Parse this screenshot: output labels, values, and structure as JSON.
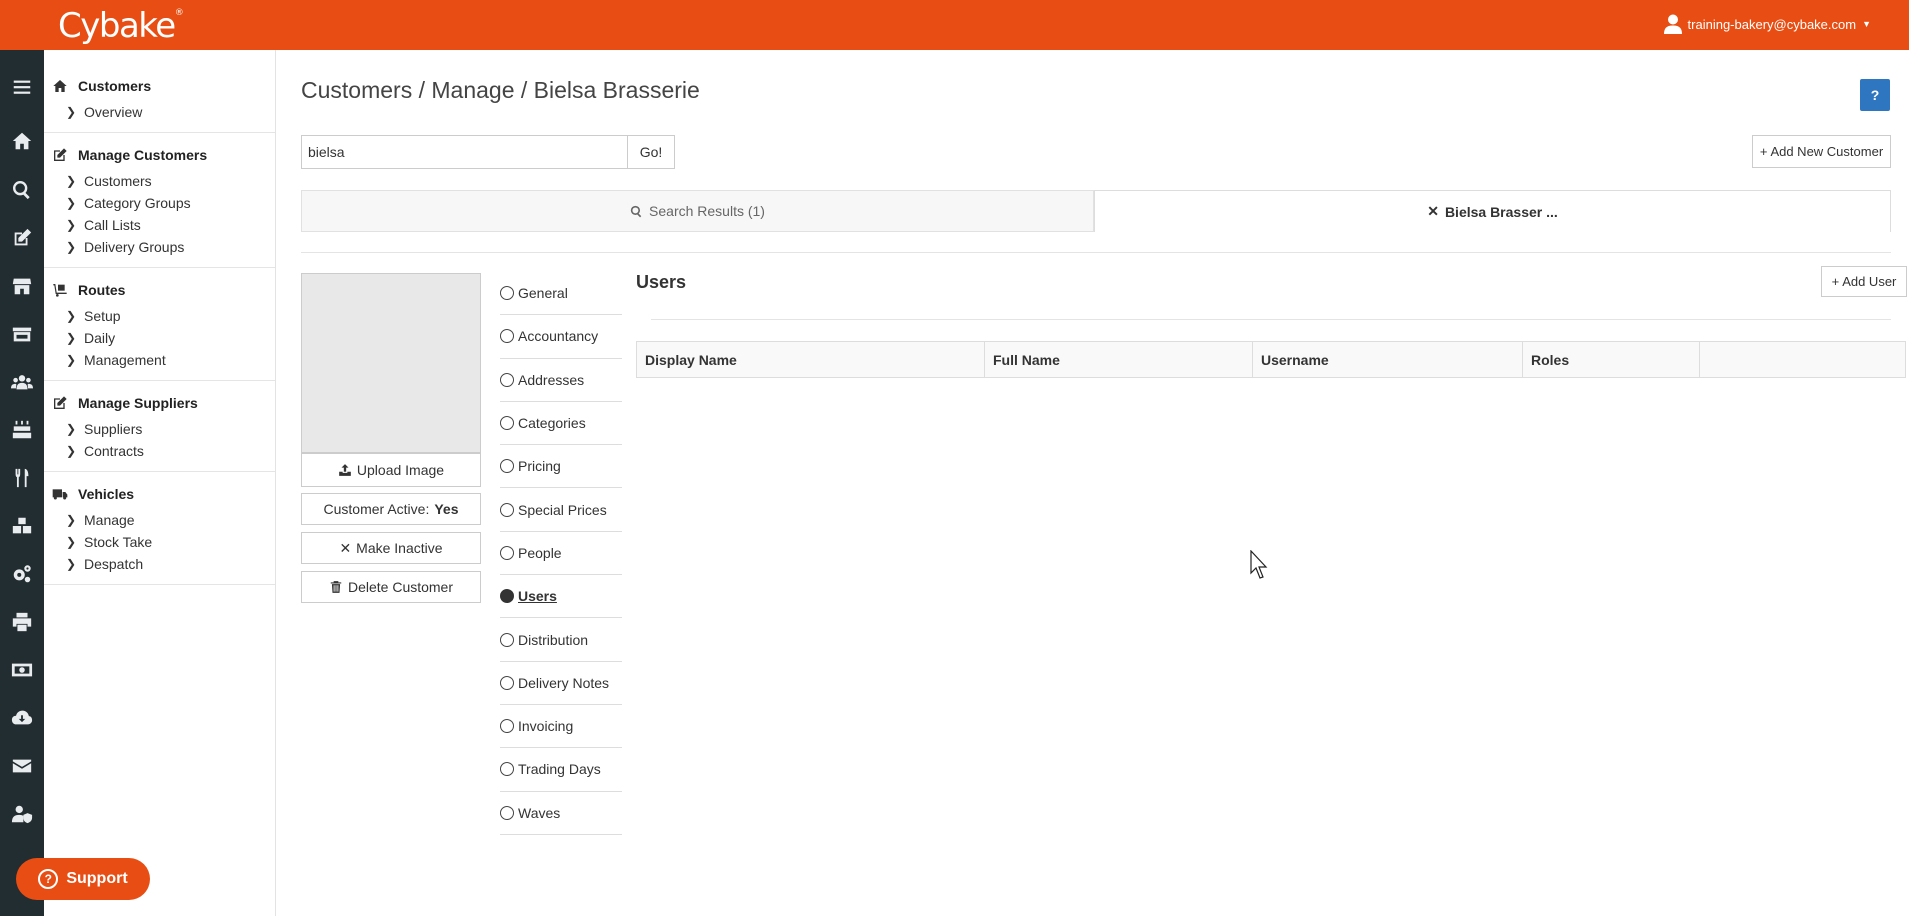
{
  "header": {
    "logo_text": "Cybake",
    "logo_mark": "®",
    "user_email": "training-bakery@cybake.com",
    "brand_color": "#E84E13"
  },
  "rail": {
    "icons": [
      "menu-icon",
      "home-icon",
      "search-icon",
      "edit-icon",
      "shop-icon",
      "store-icon",
      "people-icon",
      "cake-icon",
      "cutlery-icon",
      "boxes-icon",
      "gears-icon",
      "print-icon",
      "money-icon",
      "cloud-download-icon",
      "envelope-icon",
      "user-shield-icon"
    ]
  },
  "sidemenu": {
    "groups": [
      {
        "title": "Customers",
        "icon": "home-icon",
        "items": [
          "Overview"
        ]
      },
      {
        "title": "Manage Customers",
        "icon": "edit-icon",
        "items": [
          "Customers",
          "Category Groups",
          "Call Lists",
          "Delivery Groups"
        ]
      },
      {
        "title": "Routes",
        "icon": "dolly-icon",
        "items": [
          "Setup",
          "Daily",
          "Management"
        ]
      },
      {
        "title": "Manage Suppliers",
        "icon": "edit-icon",
        "items": [
          "Suppliers",
          "Contracts"
        ]
      },
      {
        "title": "Vehicles",
        "icon": "truck-icon",
        "items": [
          "Manage",
          "Stock Take",
          "Despatch"
        ]
      }
    ]
  },
  "support_label": "Support",
  "main": {
    "breadcrumb": "Customers / Manage / Bielsa Brasserie",
    "help_label": "?",
    "search": {
      "value": "bielsa",
      "go_label": "Go!"
    },
    "add_customer_label": "Add New Customer",
    "tabs": {
      "search_results": "Search Results (1)",
      "active": "Bielsa Brasser ..."
    },
    "card": {
      "upload_label": "Upload Image",
      "active_label": "Customer Active:",
      "active_value": "Yes",
      "make_inactive_label": "Make Inactive",
      "delete_label": "Delete Customer"
    },
    "subnav": [
      "General",
      "Accountancy",
      "Addresses",
      "Categories",
      "Pricing",
      "Special Prices",
      "People",
      "Users",
      "Distribution",
      "Delivery Notes",
      "Invoicing",
      "Trading Days",
      "Waves"
    ],
    "subnav_active": "Users",
    "panel": {
      "title": "Users",
      "add_user_label": "Add User",
      "columns": [
        "Display Name",
        "Full Name",
        "Username",
        "Roles",
        ""
      ]
    }
  }
}
